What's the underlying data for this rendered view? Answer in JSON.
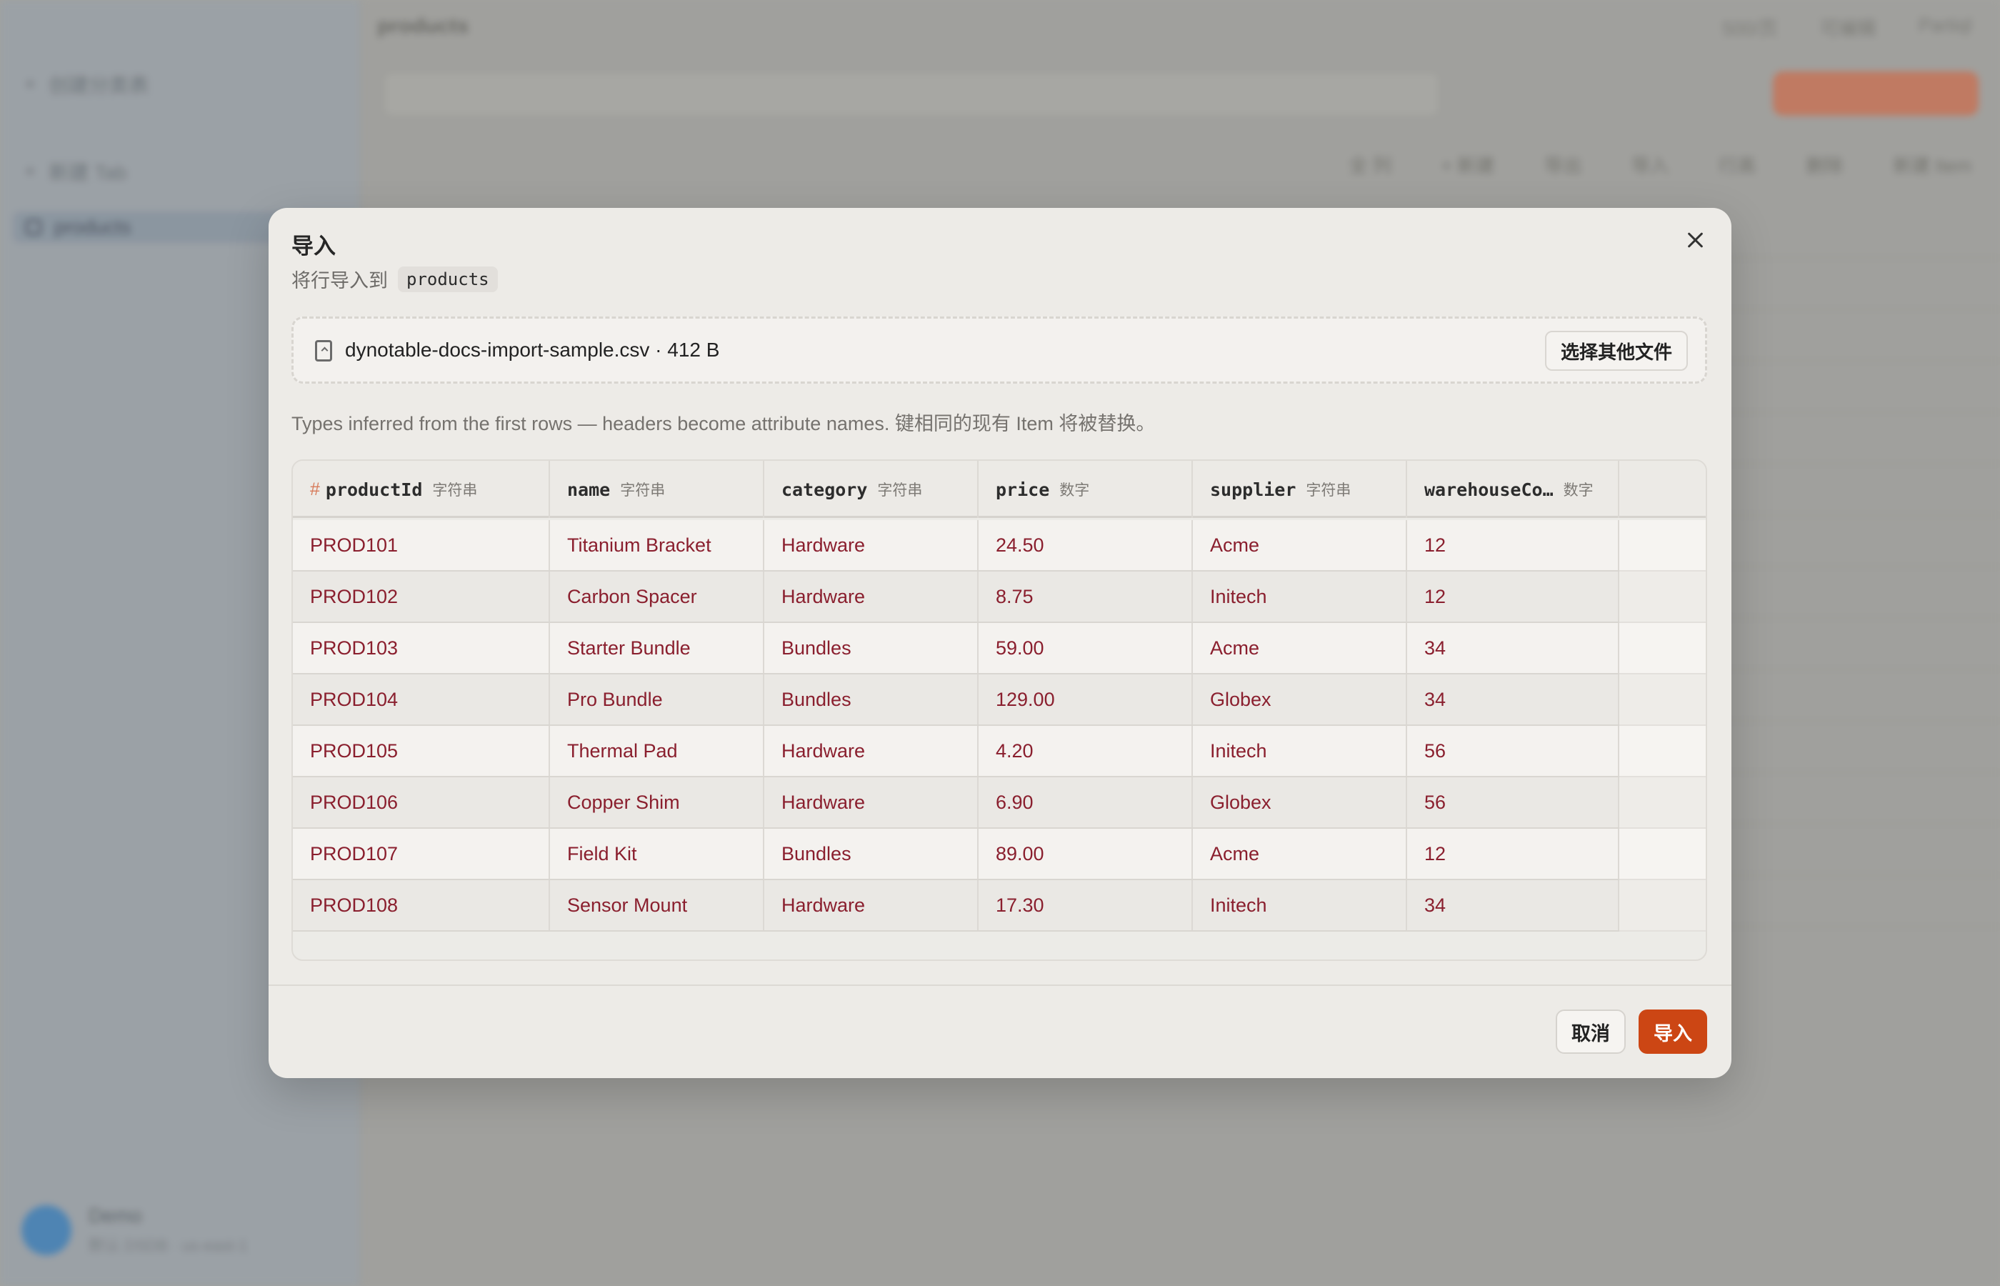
{
  "background": {
    "sidebar_items": [
      {
        "label": "创建分类表"
      },
      {
        "label": "新建 Tab"
      },
      {
        "label": "products"
      }
    ],
    "user": {
      "name": "Demo",
      "subtitle": "默认 DSDB · us-east-1"
    },
    "title": "products",
    "top_actions": [
      "500/页",
      "可编辑",
      "Partiql"
    ],
    "toolbar_actions": [
      "全 列",
      "+ 新建",
      "导出",
      "导入",
      "行高",
      "删除",
      "新建 Item"
    ]
  },
  "modal": {
    "title": "导入",
    "subtitle_prefix": "将行导入到",
    "table_name": "products",
    "file": {
      "name": "dynotable-docs-import-sample.csv · 412 B"
    },
    "choose_label": "选择其他文件",
    "hint": "Types inferred from the first rows — headers become attribute names. 键相同的现有 Item 将被替换。",
    "columns": [
      {
        "name": "productId",
        "type": "字符串",
        "key": "#"
      },
      {
        "name": "name",
        "type": "字符串"
      },
      {
        "name": "category",
        "type": "字符串"
      },
      {
        "name": "price",
        "type": "数字"
      },
      {
        "name": "supplier",
        "type": "字符串"
      },
      {
        "name": "warehouseCo…",
        "type": "数字"
      }
    ],
    "rows": [
      [
        "PROD101",
        "Titanium Bracket",
        "Hardware",
        "24.50",
        "Acme",
        "12"
      ],
      [
        "PROD102",
        "Carbon Spacer",
        "Hardware",
        "8.75",
        "Initech",
        "12"
      ],
      [
        "PROD103",
        "Starter Bundle",
        "Bundles",
        "59.00",
        "Acme",
        "34"
      ],
      [
        "PROD104",
        "Pro Bundle",
        "Bundles",
        "129.00",
        "Globex",
        "34"
      ],
      [
        "PROD105",
        "Thermal Pad",
        "Hardware",
        "4.20",
        "Initech",
        "56"
      ],
      [
        "PROD106",
        "Copper Shim",
        "Hardware",
        "6.90",
        "Globex",
        "56"
      ],
      [
        "PROD107",
        "Field Kit",
        "Bundles",
        "89.00",
        "Acme",
        "12"
      ],
      [
        "PROD108",
        "Sensor Mount",
        "Hardware",
        "17.30",
        "Initech",
        "34"
      ]
    ],
    "cancel_label": "取消",
    "import_label": "导入"
  },
  "colors": {
    "accent": "#cc4614",
    "cell_text": "#8a1f2e",
    "key_marker": "#d77b5b"
  }
}
